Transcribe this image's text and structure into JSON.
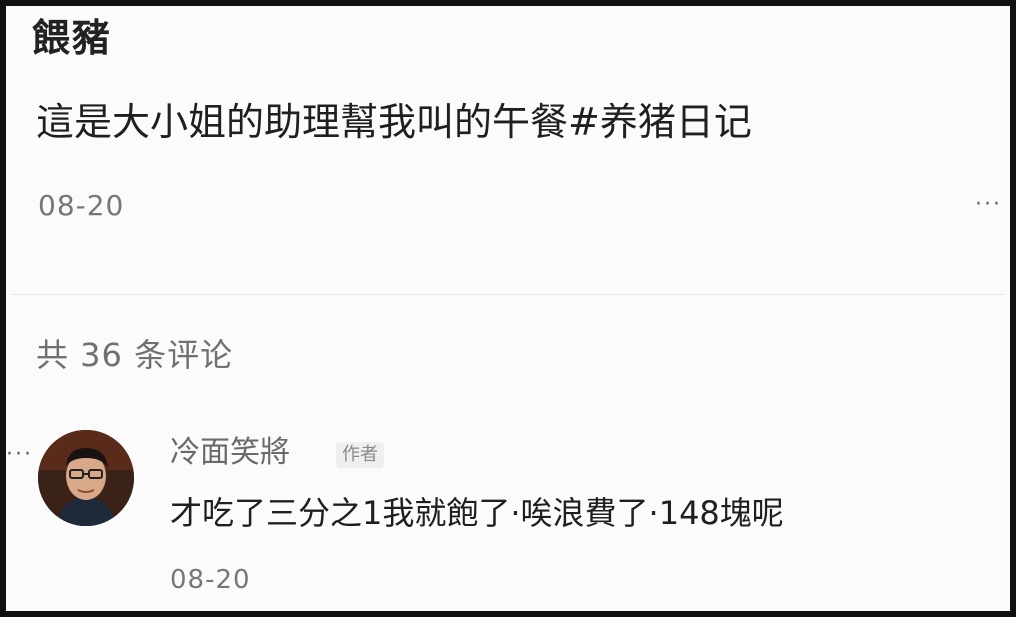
{
  "post": {
    "title": "餵豬",
    "text": "這是大小姐的助理幫我叫的午餐",
    "hashtag": "#养猪日记",
    "date": "08-20",
    "more_label": "···"
  },
  "comments_section": {
    "count_label": "共 36 条评论"
  },
  "comment": {
    "author": "冷面笑將",
    "author_badge": "作者",
    "text": "才吃了三分之1我就飽了·唉浪費了·148塊呢",
    "date": "08-20",
    "more_label": "···"
  },
  "colors": {
    "frame_border": "#111111",
    "background": "#fbfbfb",
    "primary_text": "#1f1f1f",
    "secondary_text": "#777777"
  }
}
